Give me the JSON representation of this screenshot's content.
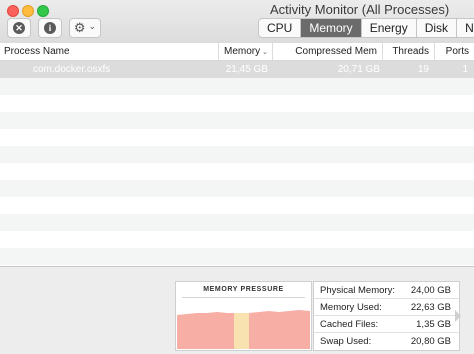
{
  "window": {
    "title": "Activity Monitor (All Processes)"
  },
  "toolbar": {
    "stop_icon": "x-circle-icon",
    "info_icon": "info-circle-icon",
    "gear_icon": "gear-icon",
    "stop_glyph": "✕",
    "info_glyph": "i",
    "gear_glyph": "⚙",
    "chevron_glyph": "⌄"
  },
  "tabs": [
    {
      "label": "CPU",
      "active": false
    },
    {
      "label": "Memory",
      "active": true
    },
    {
      "label": "Energy",
      "active": false
    },
    {
      "label": "Disk",
      "active": false
    },
    {
      "label": "N",
      "active": false
    }
  ],
  "table": {
    "columns": {
      "process_name": "Process Name",
      "memory": "Memory",
      "memory_sort_glyph": "⌄",
      "compressed_mem": "Compressed Mem",
      "threads": "Threads",
      "ports": "Ports"
    },
    "rows": [
      {
        "process_name": "com.docker.osxfs",
        "memory": "21,45 GB",
        "compressed_mem": "20,71 GB",
        "threads": "19",
        "ports": "1"
      }
    ]
  },
  "memory_panel": {
    "pressure_title": "MEMORY PRESSURE",
    "pressure_color": "#f7aea5",
    "pressure_highlight_color": "#f7e2b0",
    "stats": {
      "physical_memory": {
        "label": "Physical Memory:",
        "value": "24,00 GB"
      },
      "memory_used": {
        "label": "Memory Used:",
        "value": "22,63 GB"
      },
      "cached_files": {
        "label": "Cached Files:",
        "value": "1,35 GB"
      },
      "swap_used": {
        "label": "Swap Used:",
        "value": "20,80 GB"
      }
    }
  },
  "colors": {
    "selected_row": "#dcdcdc",
    "active_tab": "#6b6b6b"
  }
}
